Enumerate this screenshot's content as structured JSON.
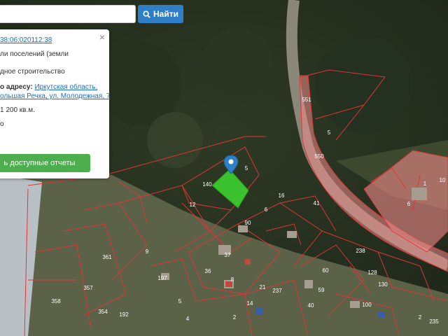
{
  "search": {
    "placeholder": "",
    "button_label": "Найти"
  },
  "popup": {
    "cadastral_number": "38:06:020112:38",
    "category": "ли поселений (земли",
    "use": "дное строительство",
    "address_label": "о адресу:",
    "address_line1": "Иркутская область,",
    "address_line2": "ольшая Речка, ул. Молодежная, 7",
    "area": "1 200 кв.м.",
    "extra": "о",
    "report_button": "ь доступные отчеты",
    "close_symbol": "×"
  },
  "map": {
    "selected_parcel_color": "#3bd12f",
    "boundary_color": "#e03535",
    "highlight_fill": "#f08a8a",
    "marker_color": "#2f7fc7",
    "parcel_labels": [
      "5",
      "140",
      "12",
      "6",
      "16",
      "41",
      "90",
      "37",
      "361",
      "9",
      "197",
      "36",
      "8",
      "357",
      "358",
      "354",
      "192",
      "5",
      "4",
      "551",
      "550",
      "5",
      "1",
      "10",
      "6",
      "237",
      "21",
      "14",
      "60",
      "59",
      "40",
      "100",
      "130",
      "128",
      "238",
      "2",
      "235",
      "2"
    ]
  }
}
